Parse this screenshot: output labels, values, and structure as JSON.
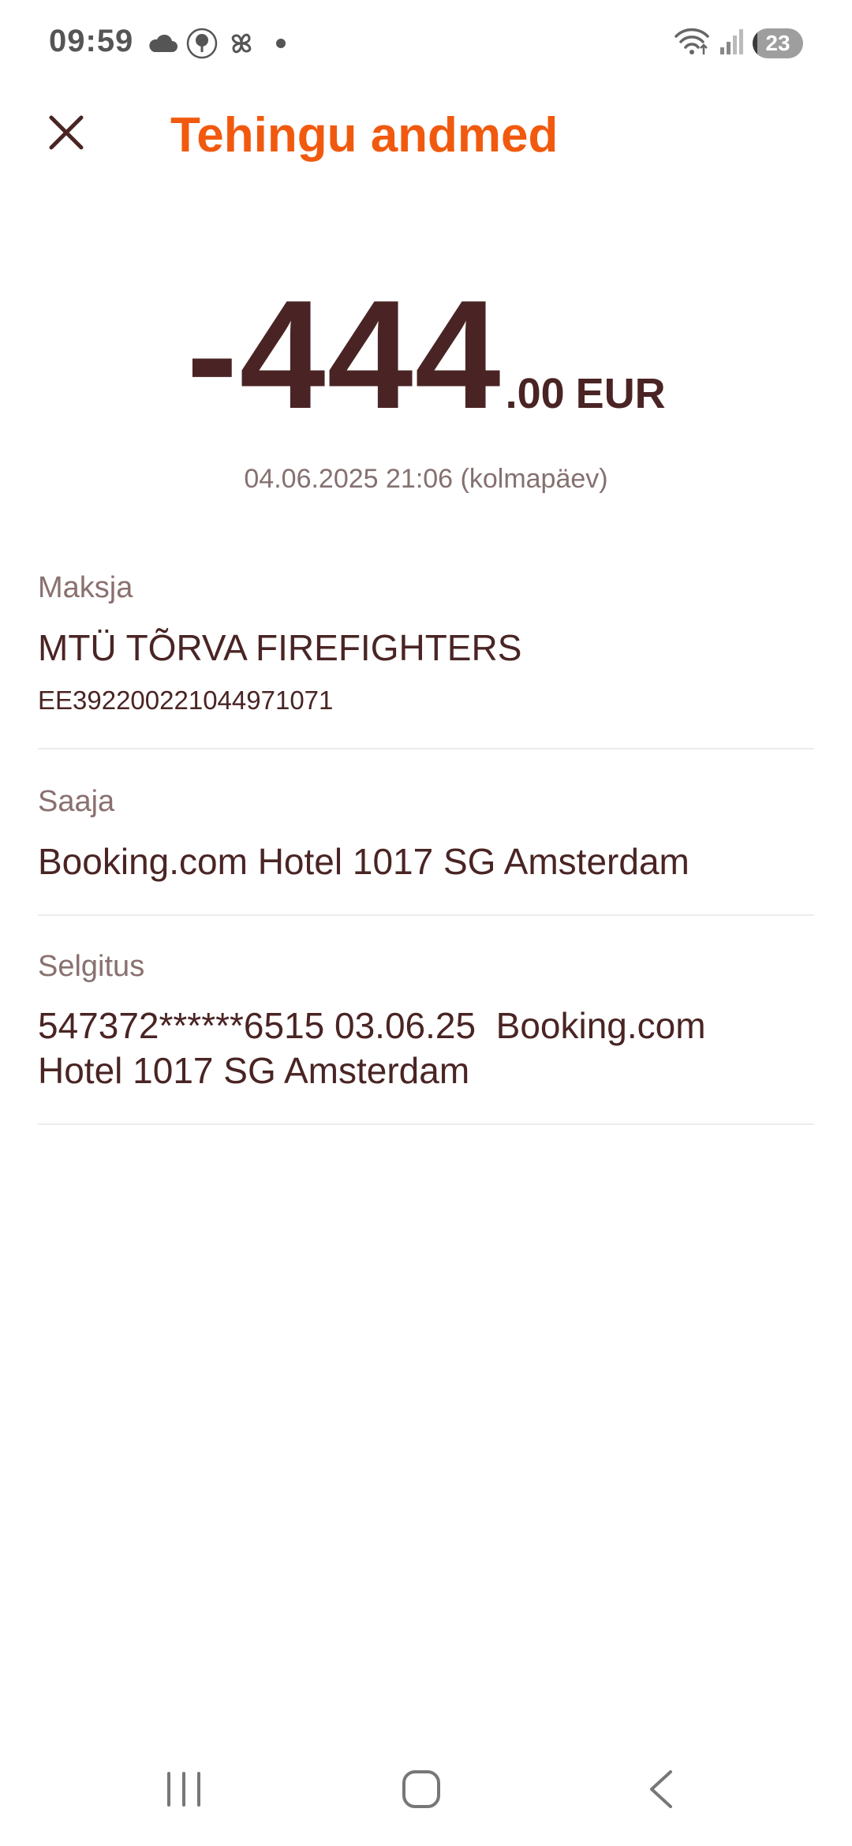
{
  "status_bar": {
    "time": "09:59",
    "battery_level": "23",
    "icons_left": [
      "cloud-icon",
      "tree-badge-icon",
      "pinwheel-icon",
      "dot-icon"
    ],
    "icons_right": [
      "wifi-icon",
      "signal-icon",
      "battery-icon"
    ]
  },
  "header": {
    "title": "Tehingu andmed",
    "close_icon": "close-icon"
  },
  "transaction": {
    "amount_main": "-444",
    "amount_cents": ".00",
    "currency": "EUR",
    "datetime": "04.06.2025 21:06 (kolmapäev)"
  },
  "details": {
    "payer": {
      "label": "Maksja",
      "name": "MTÜ TÕRVA FIREFIGHTERS",
      "iban": "EE392200221044971071"
    },
    "payee": {
      "label": "Saaja",
      "name": "Booking.com Hotel 1017 SG Amsterdam"
    },
    "explanation": {
      "label": "Selgitus",
      "text": "547372******6515 03.06.25  Booking.com Hotel 1017 SG Amsterdam"
    }
  },
  "colors": {
    "title": "#f15a0e",
    "amount": "#4a2424",
    "label": "#8a7070",
    "divider": "#ececec"
  },
  "nav_bar": {
    "recents_icon": "recents-icon",
    "home_icon": "home-icon",
    "back_icon": "back-icon"
  }
}
